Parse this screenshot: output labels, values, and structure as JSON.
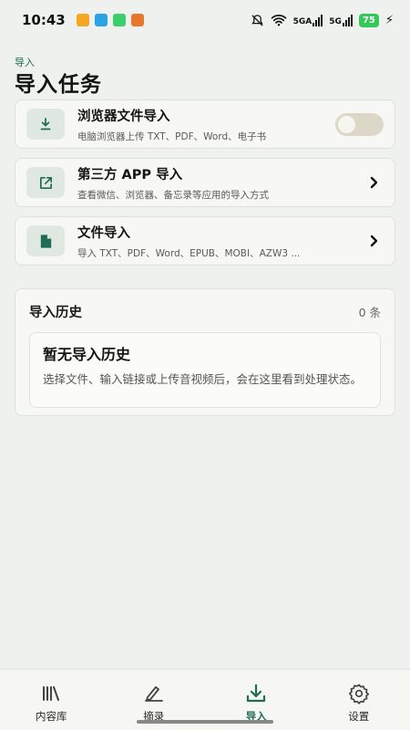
{
  "status_bar": {
    "time": "10:43",
    "network_1": "5GA",
    "network_2": "5G",
    "battery": "75",
    "app_colors": [
      "#f5a623",
      "#2aa3e0",
      "#3ccf6e",
      "#e8772e"
    ]
  },
  "header": {
    "subtitle": "导入",
    "title": "导入任务"
  },
  "tasks": [
    {
      "title": "浏览器文件导入",
      "desc": "电脑浏览器上传 TXT、PDF、Word、电子书",
      "icon": "download-icon",
      "control": "toggle",
      "toggle_on": false
    },
    {
      "title": "第三方 APP 导入",
      "desc": "查看微信、浏览器、备忘录等应用的导入方式",
      "icon": "external-link-icon",
      "control": "chevron"
    },
    {
      "title": "文件导入",
      "desc": "导入 TXT、PDF、Word、EPUB、MOBI、AZW3 ...",
      "icon": "file-icon",
      "control": "chevron"
    }
  ],
  "history": {
    "title": "导入历史",
    "count": "0 条",
    "empty_title": "暂无导入历史",
    "empty_desc": "选择文件、输入链接或上传音视频后，会在这里看到处理状态。"
  },
  "nav": {
    "items": [
      {
        "label": "内容库",
        "icon": "library-icon"
      },
      {
        "label": "摘录",
        "icon": "highlight-icon"
      },
      {
        "label": "导入",
        "icon": "import-icon",
        "active": true
      },
      {
        "label": "设置",
        "icon": "settings-icon"
      }
    ]
  },
  "colors": {
    "accent": "#1f6b56",
    "background": "#eef1ed",
    "toggle_off": "#dcd7c6"
  }
}
